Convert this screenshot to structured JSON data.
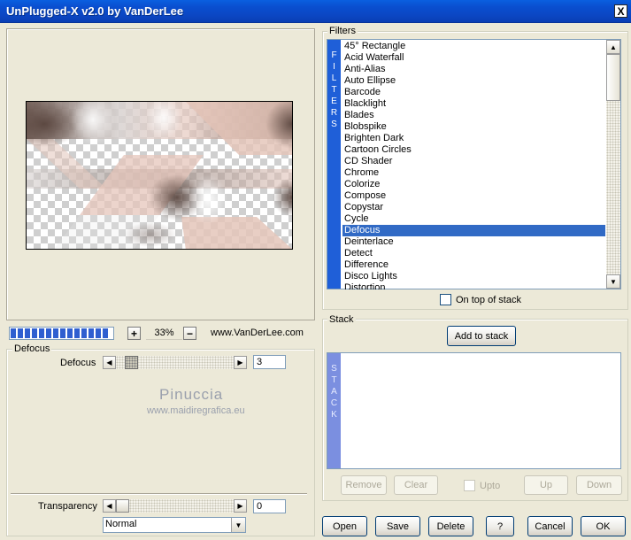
{
  "window": {
    "title": "UnPlugged-X v2.0 by VanDerLee",
    "close_glyph": "X"
  },
  "zoom": {
    "plus": "+",
    "value": "33%",
    "minus": "−"
  },
  "website": "www.VanDerLee.com",
  "progress": {
    "fraction": 1.0
  },
  "defocus_panel": {
    "legend": "Defocus",
    "param_label": "Defocus",
    "param_value": "3",
    "watermark_title": "Pinuccia",
    "watermark_url": "www.maidiregrafica.eu",
    "transparency_label": "Transparency",
    "transparency_value": "0",
    "blend_mode": "Normal"
  },
  "filters": {
    "legend": "Filters",
    "strip_letters": [
      "F",
      "I",
      "L",
      "T",
      "E",
      "R",
      "S"
    ],
    "items": [
      "45° Rectangle",
      "Acid Waterfall",
      "Anti-Alias",
      "Auto Ellipse",
      "Barcode",
      "Blacklight",
      "Blades",
      "Blobspike",
      "Brighten Dark",
      "Cartoon Circles",
      "CD Shader",
      "Chrome",
      "Colorize",
      "Compose",
      "Copystar",
      "Cycle",
      "Defocus",
      "Deinterlace",
      "Detect",
      "Difference",
      "Disco Lights",
      "Distortion"
    ],
    "selected": "Defocus",
    "on_top_label": "On top of stack"
  },
  "stack": {
    "legend": "Stack",
    "add_label": "Add to stack",
    "strip_letters": [
      "S",
      "T",
      "A",
      "C",
      "K"
    ],
    "remove_label": "Remove",
    "clear_label": "Clear",
    "upto_label": "Upto",
    "up_label": "Up",
    "down_label": "Down"
  },
  "bottom_buttons": {
    "open": "Open",
    "save": "Save",
    "delete": "Delete",
    "help": "?",
    "cancel": "Cancel",
    "ok": "OK"
  },
  "colors": {
    "titlebar": "#0a4fd0",
    "selection": "#316ac5",
    "strip": "#1f5fd8",
    "face": "#ece9d8"
  }
}
